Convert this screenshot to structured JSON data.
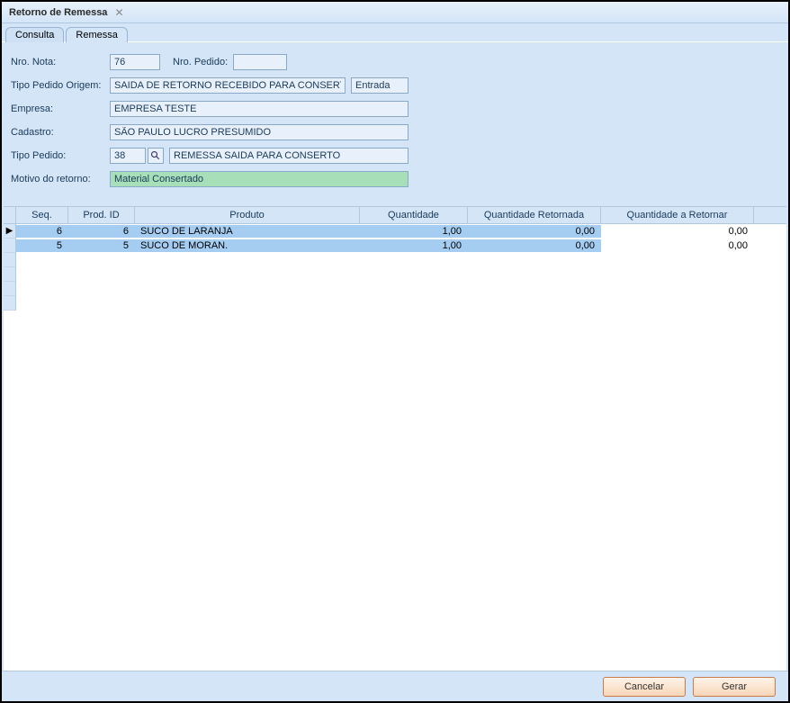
{
  "window": {
    "title": "Retorno de Remessa"
  },
  "tabs": {
    "consulta": "Consulta",
    "remessa": "Remessa",
    "active": "remessa"
  },
  "form": {
    "labels": {
      "nro_nota": "Nro. Nota:",
      "nro_pedido": "Nro. Pedido:",
      "tipo_pedido_origem": "Tipo Pedido Origem:",
      "empresa": "Empresa:",
      "cadastro": "Cadastro:",
      "tipo_pedido": "Tipo Pedido:",
      "motivo_retorno": "Motivo do retorno:"
    },
    "values": {
      "nro_nota": "76",
      "nro_pedido": "",
      "tipo_pedido_origem": "SAIDA DE RETORNO RECEBIDO PARA CONSERTO",
      "tipo_pedido_origem_dir": "Entrada",
      "empresa": "EMPRESA TESTE",
      "cadastro": "SÃO PAULO LUCRO PRESUMIDO",
      "tipo_pedido_code": "38",
      "tipo_pedido_desc": "REMESSA SAIDA PARA CONSERTO",
      "motivo_retorno": "Material Consertado"
    }
  },
  "grid": {
    "headers": {
      "seq": "Seq.",
      "prod_id": "Prod. ID",
      "produto": "Produto",
      "quantidade": "Quantidade",
      "quantidade_retornada": "Quantidade Retornada",
      "quantidade_a_retornar": "Quantidade a Retornar"
    },
    "rows": [
      {
        "seq": "6",
        "prod_id": "6",
        "produto": "SUCO DE LARANJA",
        "quantidade": "1,00",
        "quantidade_retornada": "0,00",
        "quantidade_a_retornar": "0,00"
      },
      {
        "seq": "5",
        "prod_id": "5",
        "produto": "SUCO DE MORAN.",
        "quantidade": "1,00",
        "quantidade_retornada": "0,00",
        "quantidade_a_retornar": "0,00"
      }
    ]
  },
  "buttons": {
    "cancelar": "Cancelar",
    "gerar": "Gerar"
  }
}
